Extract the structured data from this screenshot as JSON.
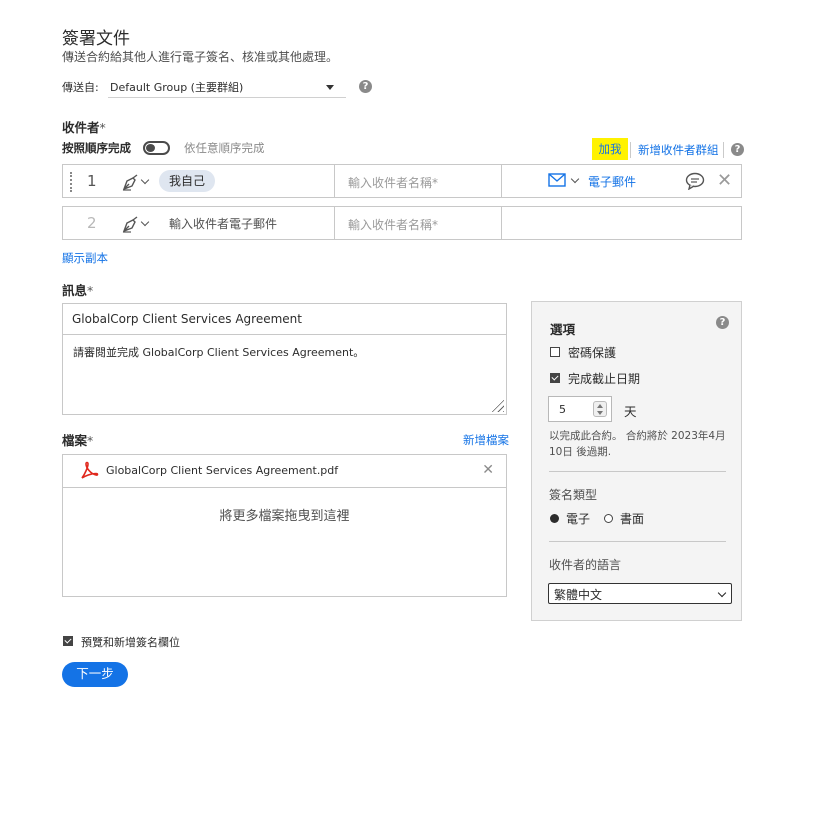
{
  "header": {
    "title": "簽署文件",
    "subtitle": "傳送合約給其他人進行電子簽名、核准或其他處理。"
  },
  "send_from": {
    "label": "傳送自:",
    "value": "Default Group (主要群組)"
  },
  "recipients": {
    "label": "收件者",
    "required_mark": "*",
    "order_label": "按照順序完成",
    "any_order_label": "依任意順序完成",
    "add_me": "加我",
    "add_group": "新增收件者群組",
    "rows": [
      {
        "number": "1",
        "email": "我自己",
        "name_placeholder": "輸入收件者名稱*",
        "delivery": "電子郵件"
      },
      {
        "number": "2",
        "email": "輸入收件者電子郵件",
        "name_placeholder": "輸入收件者名稱*",
        "delivery": ""
      }
    ],
    "show_cc": "顯示副本"
  },
  "message": {
    "label": "訊息",
    "required_mark": "*",
    "title": "GlobalCorp Client Services Agreement",
    "body": "請審閱並完成 GlobalCorp Client Services Agreement。"
  },
  "files": {
    "label": "檔案",
    "required_mark": "*",
    "add_file": "新增檔案",
    "items": [
      {
        "name": "GlobalCorp Client Services Agreement.pdf"
      }
    ],
    "drop_hint": "將更多檔案拖曳到這裡"
  },
  "options": {
    "title": "選項",
    "password_label": "密碼保護",
    "password_checked": false,
    "deadline_label": "完成截止日期",
    "deadline_checked": true,
    "days_value": "5",
    "days_unit": "天",
    "expire_note": "以完成此合約。 合約將於 2023年4月10日 後過期.",
    "sig_type_title": "簽名類型",
    "sig_type_options": [
      "電子",
      "書面"
    ],
    "sig_type_selected": "電子",
    "language_title": "收件者的語言",
    "language_value": "繁體中文"
  },
  "footer": {
    "preview_label": "預覽和新增簽名欄位",
    "preview_checked": true,
    "next_button": "下一步"
  },
  "colors": {
    "accent": "#1473e6",
    "highlight": "#fff200",
    "chip_bg": "#dfe6f0",
    "panel_bg": "#f4f4f4"
  }
}
